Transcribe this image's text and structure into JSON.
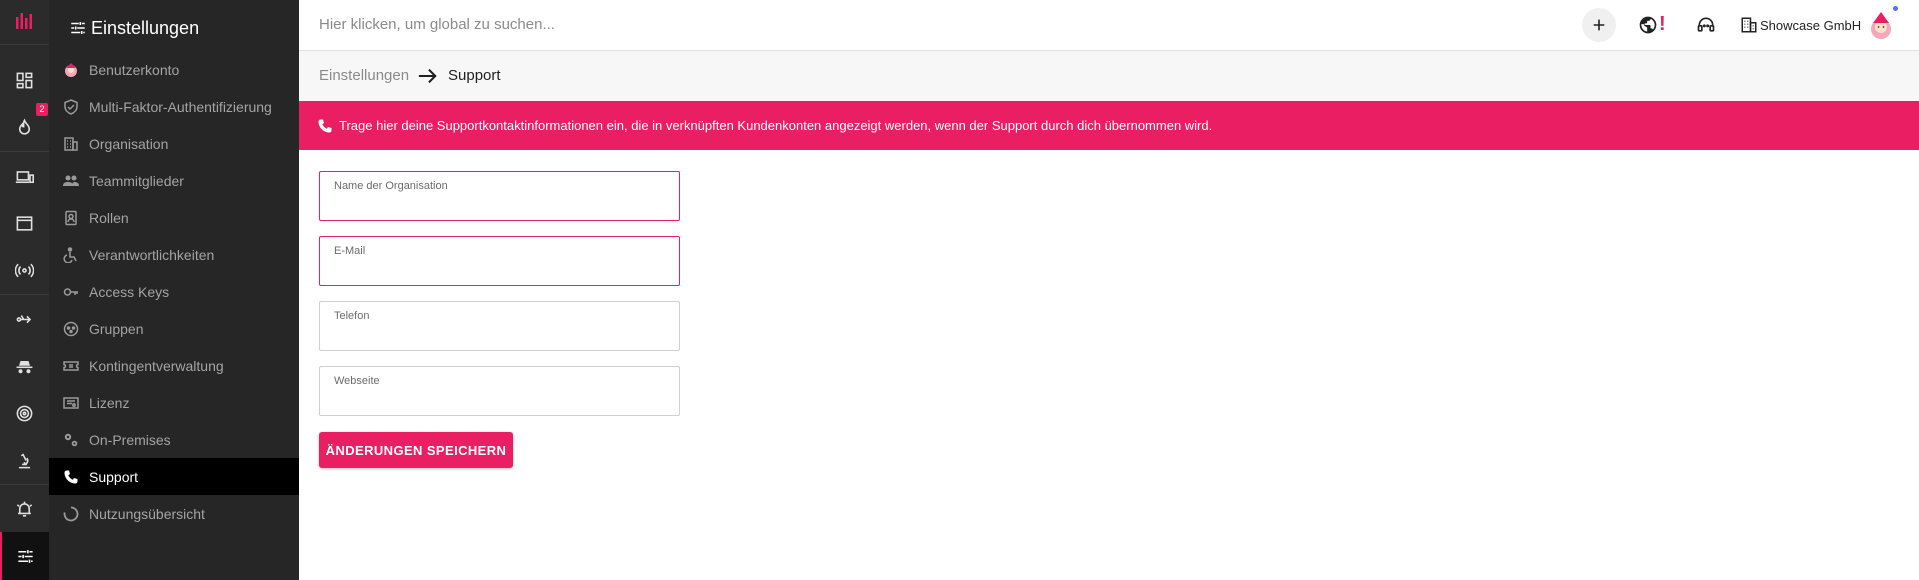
{
  "menu": {
    "title": "Einstellungen",
    "items": [
      {
        "label": "Benutzerkonto",
        "icon": "user-avatar-icon"
      },
      {
        "label": "Multi-Faktor-Authentifizierung",
        "icon": "shield-icon"
      },
      {
        "label": "Organisation",
        "icon": "building-icon"
      },
      {
        "label": "Teammitglieder",
        "icon": "people-icon"
      },
      {
        "label": "Rollen",
        "icon": "badge-icon"
      },
      {
        "label": "Verantwortlichkeiten",
        "icon": "accessibility-icon"
      },
      {
        "label": "Access Keys",
        "icon": "key-icon"
      },
      {
        "label": "Gruppen",
        "icon": "group-icon"
      },
      {
        "label": "Kontingentverwaltung",
        "icon": "ticket-icon"
      },
      {
        "label": "Lizenz",
        "icon": "license-icon"
      },
      {
        "label": "On-Premises",
        "icon": "gears-icon"
      },
      {
        "label": "Support",
        "icon": "phone-icon",
        "active": true
      },
      {
        "label": "Nutzungsübersicht",
        "icon": "circle-progress-icon"
      }
    ]
  },
  "rail": {
    "badge_count": "2"
  },
  "topbar": {
    "search_placeholder": "Hier klicken, um global zu suchen...",
    "alert_mark": "!",
    "org_name": "Showcase GmbH"
  },
  "breadcrumb": {
    "root": "Einstellungen",
    "current": "Support"
  },
  "banner": {
    "text": "Trage hier deine Supportkontaktinformationen ein, die in verknüpften Kundenkonten angezeigt werden, wenn der Support durch dich übernommen wird."
  },
  "form": {
    "fields": [
      {
        "label": "Name der Organisation",
        "value": "",
        "error": true
      },
      {
        "label": "E-Mail",
        "value": "",
        "error": true
      },
      {
        "label": "Telefon",
        "value": "",
        "error": false
      },
      {
        "label": "Webseite",
        "value": "",
        "error": false
      }
    ],
    "save_label": "ÄNDERUNGEN SPEICHERN"
  },
  "colors": {
    "accent": "#e91e63",
    "rail_bg": "#2b2b2b",
    "menu_bg": "#262626"
  }
}
